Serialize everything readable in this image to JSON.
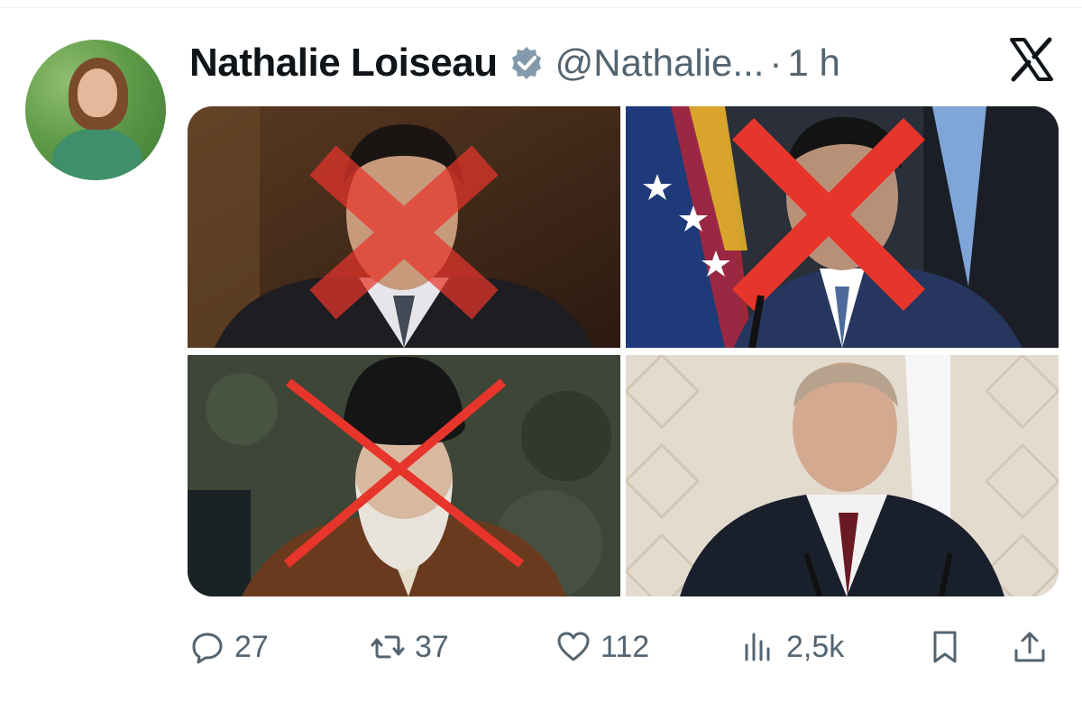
{
  "tweet": {
    "author": {
      "display_name": "Nathalie Loiseau",
      "handle": "@Nathalie...",
      "verified": true
    },
    "separator": "·",
    "timestamp": "1 h",
    "platform_icon": "x-logo-icon",
    "media": [
      {
        "name": "media-photo-1",
        "overlay": "red-x",
        "description_icon": "photo-icon"
      },
      {
        "name": "media-photo-2",
        "overlay": "red-x",
        "description_icon": "photo-icon"
      },
      {
        "name": "media-photo-3",
        "overlay": "red-x",
        "description_icon": "photo-icon"
      },
      {
        "name": "media-photo-4",
        "overlay": "none",
        "description_icon": "photo-icon"
      }
    ],
    "actions": {
      "replies": "27",
      "reposts": "37",
      "likes": "112",
      "views": "2,5k"
    }
  },
  "colors": {
    "text_primary": "#0f1419",
    "text_secondary": "#536471",
    "cross_red": "#e8352b",
    "verified_badge": "#829aab"
  }
}
